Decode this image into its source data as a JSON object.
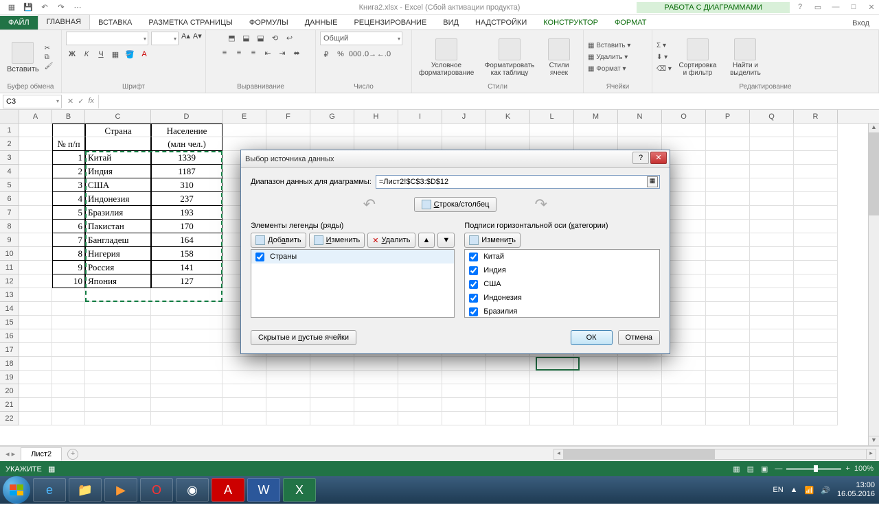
{
  "titlebar": {
    "title": "Книга2.xlsx - Excel (Сбой активации продукта)",
    "tools_title": "РАБОТА С ДИАГРАММАМИ"
  },
  "ribbon_tabs": {
    "file": "ФАЙЛ",
    "tabs": [
      "ГЛАВНАЯ",
      "ВСТАВКА",
      "РАЗМЕТКА СТРАНИЦЫ",
      "ФОРМУЛЫ",
      "ДАННЫЕ",
      "РЕЦЕНЗИРОВАНИЕ",
      "ВИД",
      "НАДСТРОЙКИ"
    ],
    "ctx_tabs": [
      "КОНСТРУКТОР",
      "ФОРМАТ"
    ],
    "login": "Вход"
  },
  "ribbon": {
    "clipboard": {
      "paste": "Вставить",
      "label": "Буфер обмена"
    },
    "font": {
      "label": "Шрифт",
      "bold": "Ж",
      "italic": "К",
      "underline": "Ч"
    },
    "align": {
      "label": "Выравнивание"
    },
    "number": {
      "label": "Число",
      "format": "Общий"
    },
    "styles": {
      "label": "Стили",
      "cond": "Условное форматирование",
      "table": "Форматировать как таблицу",
      "cell": "Стили ячеек"
    },
    "cells": {
      "label": "Ячейки",
      "insert": "Вставить",
      "delete": "Удалить",
      "format": "Формат"
    },
    "editing": {
      "label": "Редактирование",
      "sort": "Сортировка и фильтр",
      "find": "Найти и выделить"
    }
  },
  "namebox": "C3",
  "columns": [
    "A",
    "B",
    "C",
    "D",
    "E",
    "F",
    "G",
    "H",
    "I",
    "J",
    "K",
    "L",
    "M",
    "N",
    "O",
    "P",
    "Q",
    "R"
  ],
  "table": {
    "headers": {
      "num": "№ п/п",
      "country": "Страна",
      "pop1": "Население",
      "pop2": "(млн чел.)"
    },
    "rows": [
      {
        "n": "1",
        "c": "Китай",
        "p": "1339"
      },
      {
        "n": "2",
        "c": "Индия",
        "p": "1187"
      },
      {
        "n": "3",
        "c": "США",
        "p": "310"
      },
      {
        "n": "4",
        "c": "Индонезия",
        "p": "237"
      },
      {
        "n": "5",
        "c": "Бразилия",
        "p": "193"
      },
      {
        "n": "6",
        "c": "Пакистан",
        "p": "170"
      },
      {
        "n": "7",
        "c": "Бангладеш",
        "p": "164"
      },
      {
        "n": "8",
        "c": "Нигерия",
        "p": "158"
      },
      {
        "n": "9",
        "c": "Россия",
        "p": "141"
      },
      {
        "n": "10",
        "c": "Япония",
        "p": "127"
      }
    ]
  },
  "dialog": {
    "title": "Выбор источника данных",
    "range_label": "Диапазон данных для диаграммы:",
    "range_value": "=Лист2!$C$3:$D$12",
    "swap": "Строка/столбец",
    "legend_label": "Элементы легенды (ряды)",
    "axis_label": "Подписи горизонтальной оси (категории)",
    "add": "Добавить",
    "edit": "Изменить",
    "delete": "Удалить",
    "series": [
      "Страны"
    ],
    "categories": [
      "Китай",
      "Индия",
      "США",
      "Индонезия",
      "Бразилия"
    ],
    "hidden": "Скрытые и пустые ячейки",
    "ok": "ОК",
    "cancel": "Отмена"
  },
  "sheet": {
    "name": "Лист2"
  },
  "status": {
    "mode": "УКАЖИТЕ",
    "zoom": "100%"
  },
  "taskbar": {
    "lang": "EN",
    "time": "13:00",
    "date": "16.05.2016"
  }
}
